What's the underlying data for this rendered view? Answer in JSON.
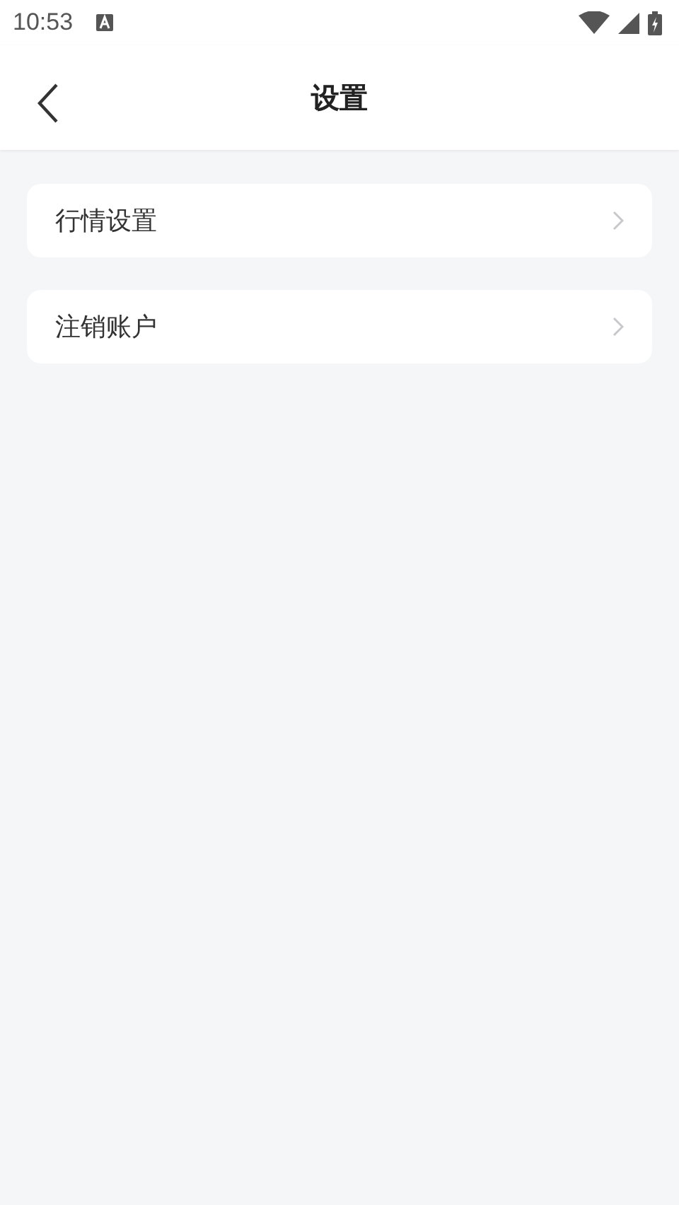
{
  "status_bar": {
    "time": "10:53"
  },
  "header": {
    "title": "设置"
  },
  "items": [
    {
      "label": "行情设置"
    },
    {
      "label": "注销账户"
    }
  ]
}
